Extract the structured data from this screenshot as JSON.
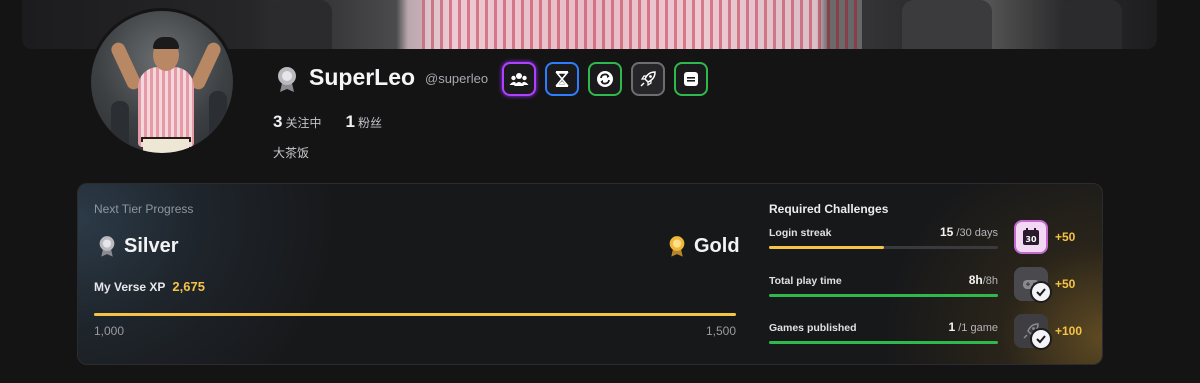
{
  "profile": {
    "username": "SuperLeo",
    "handle": "@superleo",
    "following_count": "3",
    "following_label": "关注中",
    "followers_count": "1",
    "followers_label": "粉丝",
    "bio": "大茶饭",
    "badges": [
      {
        "icon": "community-icon",
        "color": "#b040ff"
      },
      {
        "icon": "hourglass-icon",
        "color": "#2f7dff"
      },
      {
        "icon": "refresh-icon",
        "color": "#2fb84b"
      },
      {
        "icon": "rocket-icon",
        "color": "#6d6d72"
      },
      {
        "icon": "document-icon",
        "color": "#2fb84b"
      }
    ]
  },
  "progress": {
    "label": "Next Tier Progress",
    "current_tier": "Silver",
    "next_tier": "Gold",
    "xp_label": "My Verse XP",
    "xp_value": "2,675",
    "xp_min": "1,000",
    "xp_max": "1,500",
    "xp_fraction": 1.0
  },
  "challenges": {
    "title": "Required Challenges",
    "items": [
      {
        "name": "Login streak",
        "current": "15",
        "total": "/30 days",
        "fraction": 0.5,
        "fill_color": "#f5c445",
        "reward": "+50",
        "icon": "calendar-30-icon",
        "completed": false
      },
      {
        "name": "Total play time",
        "current": "8h",
        "total": "/8h",
        "fraction": 1.0,
        "fill_color": "#2fb84b",
        "reward": "+50",
        "icon": "gamepad-icon",
        "completed": true
      },
      {
        "name": "Games published",
        "current": "1",
        "total": "/1 game",
        "fraction": 1.0,
        "fill_color": "#2fb84b",
        "reward": "+100",
        "icon": "rocket-icon",
        "completed": true
      }
    ]
  },
  "colors": {
    "accent_gold": "#f5c445",
    "accent_green": "#2fb84b",
    "background": "#141415"
  }
}
